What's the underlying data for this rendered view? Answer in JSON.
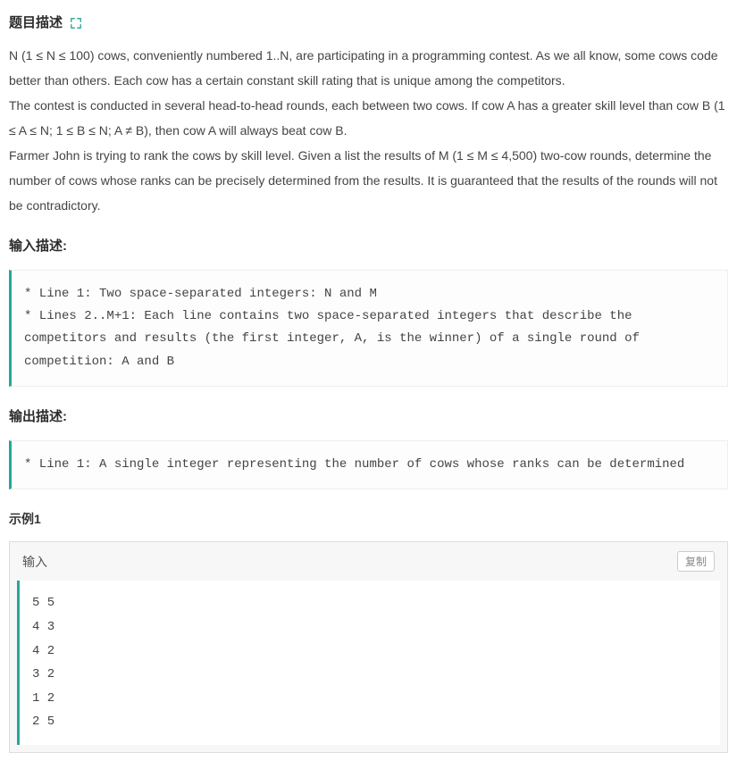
{
  "headers": {
    "problem_description": "题目描述",
    "input_description": "输入描述:",
    "output_description": "输出描述:",
    "example_label": "示例1",
    "input_label": "输入",
    "copy_label": "复制"
  },
  "description": {
    "p1": "N (1 ≤ N ≤ 100) cows, conveniently numbered 1..N, are participating in a programming contest. As we all know, some cows code better than others. Each cow has a certain constant skill rating that is unique among the competitors.",
    "p2": "The contest is conducted in several head-to-head rounds, each between two cows. If cow A has a greater skill level than cow B (1 ≤ A ≤ N; 1 ≤ B ≤ N; A ≠ B), then cow A will always beat cow B.",
    "p3": "Farmer John is trying to rank the cows by skill level. Given a list the results of M (1 ≤ M ≤ 4,500) two-cow rounds, determine the number of cows whose ranks can be precisely determined from the results. It is guaranteed that the results of the rounds will not be contradictory."
  },
  "input_description_text": "* Line 1: Two space-separated integers: N and M\n* Lines 2..M+1: Each line contains two space-separated integers that describe the competitors and results (the first integer, A, is the winner) of a single round of competition: A and B",
  "output_description_text": "* Line 1: A single integer representing the number of cows whose ranks can be determined",
  "example_input": "5 5\n4 3\n4 2\n3 2\n1 2\n2 5"
}
